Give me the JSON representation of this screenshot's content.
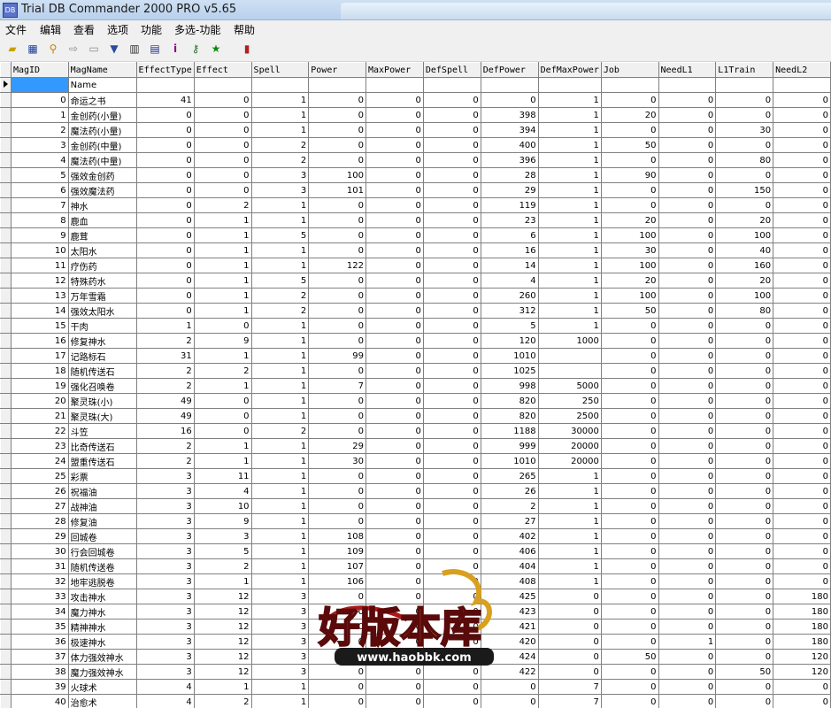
{
  "window": {
    "title": "Trial DB Commander 2000 PRO v5.65"
  },
  "menu": [
    "文件",
    "编辑",
    "查看",
    "选项",
    "功能",
    "多选-功能",
    "帮助"
  ],
  "toolbar_icons": [
    "open-folder-icon",
    "table-icon",
    "find-icon",
    "arrow-right-icon",
    "export-icon",
    "filter-icon",
    "trash-icon",
    "database-icon",
    "info-icon",
    "search-key-icon",
    "run-icon",
    "exit-icon"
  ],
  "grid": {
    "columns": [
      "MagID",
      "MagName",
      "EffectType",
      "Effect",
      "Spell",
      "Power",
      "MaxPower",
      "DefSpell",
      "DefPower",
      "DefMaxPower",
      "Job",
      "NeedL1",
      "L1Train",
      "NeedL2"
    ],
    "edit_row": {
      "magname_value": "Name"
    },
    "rows": [
      [
        "0",
        "命运之书",
        "41",
        "0",
        "1",
        "0",
        "0",
        "0",
        "0",
        "1",
        "0",
        "0",
        "0",
        "0"
      ],
      [
        "1",
        "金创药(小量)",
        "0",
        "0",
        "1",
        "0",
        "0",
        "0",
        "398",
        "1",
        "20",
        "0",
        "0",
        "0"
      ],
      [
        "2",
        "魔法药(小量)",
        "0",
        "0",
        "1",
        "0",
        "0",
        "0",
        "394",
        "1",
        "0",
        "0",
        "30",
        "0"
      ],
      [
        "3",
        "金创药(中量)",
        "0",
        "0",
        "2",
        "0",
        "0",
        "0",
        "400",
        "1",
        "50",
        "0",
        "0",
        "0"
      ],
      [
        "4",
        "魔法药(中量)",
        "0",
        "0",
        "2",
        "0",
        "0",
        "0",
        "396",
        "1",
        "0",
        "0",
        "80",
        "0"
      ],
      [
        "5",
        "强效金创药",
        "0",
        "0",
        "3",
        "100",
        "0",
        "0",
        "28",
        "1",
        "90",
        "0",
        "0",
        "0"
      ],
      [
        "6",
        "强效魔法药",
        "0",
        "0",
        "3",
        "101",
        "0",
        "0",
        "29",
        "1",
        "0",
        "0",
        "150",
        "0"
      ],
      [
        "7",
        "神水",
        "0",
        "2",
        "1",
        "0",
        "0",
        "0",
        "119",
        "1",
        "0",
        "0",
        "0",
        "0"
      ],
      [
        "8",
        "鹿血",
        "0",
        "1",
        "1",
        "0",
        "0",
        "0",
        "23",
        "1",
        "20",
        "0",
        "20",
        "0"
      ],
      [
        "9",
        "鹿茸",
        "0",
        "1",
        "5",
        "0",
        "0",
        "0",
        "6",
        "1",
        "100",
        "0",
        "100",
        "0"
      ],
      [
        "10",
        "太阳水",
        "0",
        "1",
        "1",
        "0",
        "0",
        "0",
        "16",
        "1",
        "30",
        "0",
        "40",
        "0"
      ],
      [
        "11",
        "疗伤药",
        "0",
        "1",
        "1",
        "122",
        "0",
        "0",
        "14",
        "1",
        "100",
        "0",
        "160",
        "0"
      ],
      [
        "12",
        "特殊药水",
        "0",
        "1",
        "5",
        "0",
        "0",
        "0",
        "4",
        "1",
        "20",
        "0",
        "20",
        "0"
      ],
      [
        "13",
        "万年雪霜",
        "0",
        "1",
        "2",
        "0",
        "0",
        "0",
        "260",
        "1",
        "100",
        "0",
        "100",
        "0"
      ],
      [
        "14",
        "强效太阳水",
        "0",
        "1",
        "2",
        "0",
        "0",
        "0",
        "312",
        "1",
        "50",
        "0",
        "80",
        "0"
      ],
      [
        "15",
        "干肉",
        "1",
        "0",
        "1",
        "0",
        "0",
        "0",
        "5",
        "1",
        "0",
        "0",
        "0",
        "0"
      ],
      [
        "16",
        "修复神水",
        "2",
        "9",
        "1",
        "0",
        "0",
        "0",
        "120",
        "1000",
        "0",
        "0",
        "0",
        "0"
      ],
      [
        "17",
        "记路标石",
        "31",
        "1",
        "1",
        "99",
        "0",
        "0",
        "1010",
        "",
        "0",
        "0",
        "0",
        "0"
      ],
      [
        "18",
        "随机传送石",
        "2",
        "2",
        "1",
        "0",
        "0",
        "0",
        "1025",
        "",
        "0",
        "0",
        "0",
        "0"
      ],
      [
        "19",
        "强化召唤卷",
        "2",
        "1",
        "1",
        "7",
        "0",
        "0",
        "998",
        "5000",
        "0",
        "0",
        "0",
        "0"
      ],
      [
        "20",
        "聚灵珠(小)",
        "49",
        "0",
        "1",
        "0",
        "0",
        "0",
        "820",
        "250",
        "0",
        "0",
        "0",
        "0"
      ],
      [
        "21",
        "聚灵珠(大)",
        "49",
        "0",
        "1",
        "0",
        "0",
        "0",
        "820",
        "2500",
        "0",
        "0",
        "0",
        "0"
      ],
      [
        "22",
        "斗笠",
        "16",
        "0",
        "2",
        "0",
        "0",
        "0",
        "1188",
        "30000",
        "0",
        "0",
        "0",
        "0"
      ],
      [
        "23",
        "比奇传送石",
        "2",
        "1",
        "1",
        "29",
        "0",
        "0",
        "999",
        "20000",
        "0",
        "0",
        "0",
        "0"
      ],
      [
        "24",
        "盟重传送石",
        "2",
        "1",
        "1",
        "30",
        "0",
        "0",
        "1010",
        "20000",
        "0",
        "0",
        "0",
        "0"
      ],
      [
        "25",
        "彩票",
        "3",
        "11",
        "1",
        "0",
        "0",
        "0",
        "265",
        "1",
        "0",
        "0",
        "0",
        "0"
      ],
      [
        "26",
        "祝福油",
        "3",
        "4",
        "1",
        "0",
        "0",
        "0",
        "26",
        "1",
        "0",
        "0",
        "0",
        "0"
      ],
      [
        "27",
        "战神油",
        "3",
        "10",
        "1",
        "0",
        "0",
        "0",
        "2",
        "1",
        "0",
        "0",
        "0",
        "0"
      ],
      [
        "28",
        "修复油",
        "3",
        "9",
        "1",
        "0",
        "0",
        "0",
        "27",
        "1",
        "0",
        "0",
        "0",
        "0"
      ],
      [
        "29",
        "回城卷",
        "3",
        "3",
        "1",
        "108",
        "0",
        "0",
        "402",
        "1",
        "0",
        "0",
        "0",
        "0"
      ],
      [
        "30",
        "行会回城卷",
        "3",
        "5",
        "1",
        "109",
        "0",
        "0",
        "406",
        "1",
        "0",
        "0",
        "0",
        "0"
      ],
      [
        "31",
        "随机传送卷",
        "3",
        "2",
        "1",
        "107",
        "0",
        "0",
        "404",
        "1",
        "0",
        "0",
        "0",
        "0"
      ],
      [
        "32",
        "地牢逃脱卷",
        "3",
        "1",
        "1",
        "106",
        "0",
        "0",
        "408",
        "1",
        "0",
        "0",
        "0",
        "0"
      ],
      [
        "33",
        "攻击神水",
        "3",
        "12",
        "3",
        "0",
        "0",
        "0",
        "425",
        "0",
        "0",
        "0",
        "0",
        "180"
      ],
      [
        "34",
        "魔力神水",
        "3",
        "12",
        "3",
        "0",
        "0",
        "0",
        "423",
        "0",
        "0",
        "0",
        "0",
        "180"
      ],
      [
        "35",
        "精神神水",
        "3",
        "12",
        "3",
        "0",
        "0",
        "0",
        "421",
        "0",
        "0",
        "0",
        "0",
        "180"
      ],
      [
        "36",
        "极速神水",
        "3",
        "12",
        "3",
        "0",
        "0",
        "0",
        "420",
        "0",
        "0",
        "1",
        "0",
        "180"
      ],
      [
        "37",
        "体力强效神水",
        "3",
        "12",
        "3",
        "0",
        "0",
        "0",
        "424",
        "0",
        "50",
        "0",
        "0",
        "120"
      ],
      [
        "38",
        "魔力强效神水",
        "3",
        "12",
        "3",
        "0",
        "0",
        "0",
        "422",
        "0",
        "0",
        "0",
        "50",
        "120"
      ],
      [
        "39",
        "火球术",
        "4",
        "1",
        "1",
        "0",
        "0",
        "0",
        "0",
        "7",
        "0",
        "0",
        "0",
        "0"
      ],
      [
        "40",
        "治愈术",
        "4",
        "2",
        "1",
        "0",
        "0",
        "0",
        "0",
        "7",
        "0",
        "0",
        "0",
        "0"
      ]
    ]
  },
  "watermark": {
    "logo_text": "好版本库",
    "url_text": "www.haobbk.com"
  }
}
